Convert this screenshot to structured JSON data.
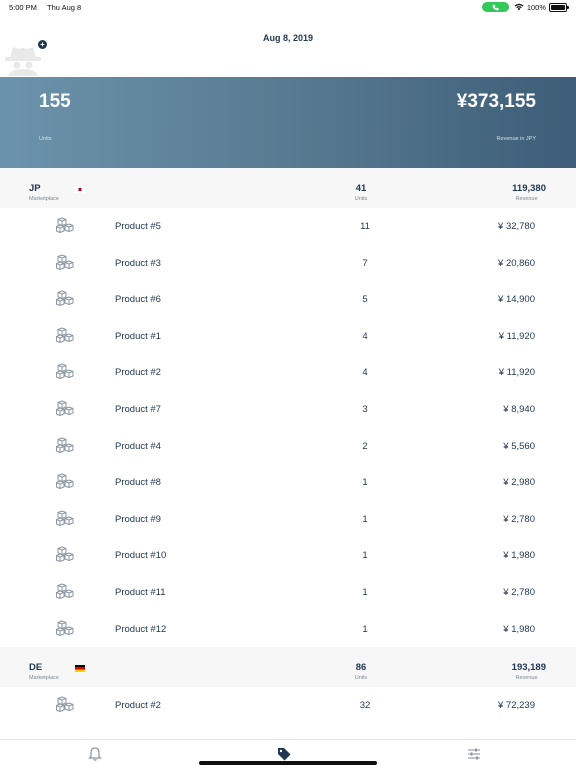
{
  "status_bar": {
    "time": "5:00 PM",
    "date": "Thu Aug 8",
    "battery": "100%",
    "battery_level": 1.0
  },
  "header": {
    "date": "Aug 8, 2019"
  },
  "summary": {
    "units_value": "155",
    "units_label": "Units",
    "revenue_value": "¥373,155",
    "revenue_label": "Revenue in JPY"
  },
  "marketplaces": [
    {
      "code": "JP",
      "label": "Marketplace",
      "flag": "japan-flag",
      "units": "41",
      "units_label": "Units",
      "revenue": "119,380",
      "revenue_label": "Revenue",
      "products": [
        {
          "name": "Product #5",
          "units": "11",
          "revenue": "¥ 32,780"
        },
        {
          "name": "Product #3",
          "units": "7",
          "revenue": "¥ 20,860"
        },
        {
          "name": "Product #6",
          "units": "5",
          "revenue": "¥ 14,900"
        },
        {
          "name": "Product #1",
          "units": "4",
          "revenue": "¥ 11,920"
        },
        {
          "name": "Product #2",
          "units": "4",
          "revenue": "¥ 11,920"
        },
        {
          "name": "Product #7",
          "units": "3",
          "revenue": "¥ 8,940"
        },
        {
          "name": "Product #4",
          "units": "2",
          "revenue": "¥ 5,560"
        },
        {
          "name": "Product #8",
          "units": "1",
          "revenue": "¥ 2,980"
        },
        {
          "name": "Product #9",
          "units": "1",
          "revenue": "¥ 2,780"
        },
        {
          "name": "Product #10",
          "units": "1",
          "revenue": "¥ 1,980"
        },
        {
          "name": "Product #11",
          "units": "1",
          "revenue": "¥ 2,780"
        },
        {
          "name": "Product #12",
          "units": "1",
          "revenue": "¥ 1,980"
        }
      ]
    },
    {
      "code": "DE",
      "label": "Marketplace",
      "flag": "germany-flag",
      "units": "86",
      "units_label": "Units",
      "revenue": "193,189",
      "revenue_label": "Revenue",
      "products": [
        {
          "name": "Product #2",
          "units": "32",
          "revenue": "¥ 72,239"
        }
      ]
    }
  ],
  "tabs": [
    {
      "name": "notifications",
      "icon": "bell-icon"
    },
    {
      "name": "sales",
      "icon": "tag-icon",
      "active": true
    },
    {
      "name": "filters",
      "icon": "sliders-icon"
    }
  ],
  "colors": {
    "primary": "#1f3550",
    "banner_start": "#6b93ab",
    "banner_end": "#3d5d78",
    "muted": "#7c8794"
  }
}
